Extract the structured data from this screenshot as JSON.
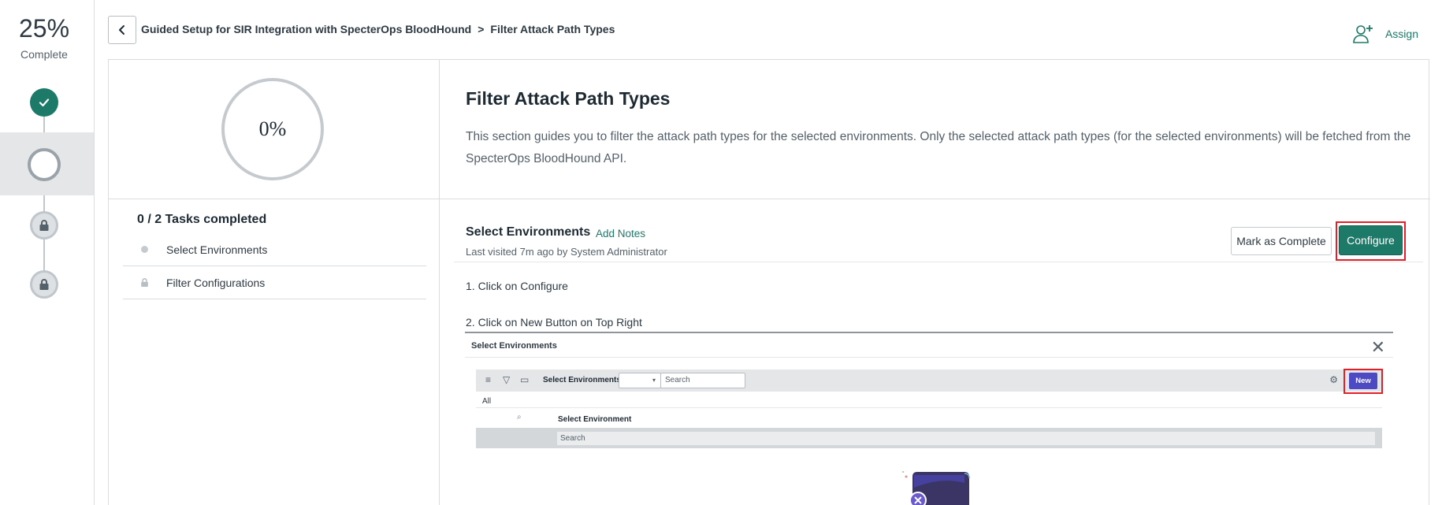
{
  "progress": {
    "percent": "25%",
    "label": "Complete"
  },
  "steps": [
    {
      "state": "done",
      "icon": "check-icon"
    },
    {
      "state": "current",
      "icon": "circle-icon"
    },
    {
      "state": "locked",
      "icon": "lock-icon"
    },
    {
      "state": "locked",
      "icon": "lock-icon"
    }
  ],
  "header": {
    "breadcrumb_parent": "Guided Setup for SIR Integration with SpecterOps BloodHound",
    "breadcrumb_sep": ">",
    "breadcrumb_current": "Filter Attack Path Types",
    "assign_label": "Assign"
  },
  "section": {
    "progress": "0%",
    "title": "Filter Attack Path Types",
    "description": "This section guides you to filter the attack path types for the selected environments. Only the selected attack path types (for the selected environments) will be fetched from the SpecterOps BloodHound API."
  },
  "tasks": {
    "summary": "0 / 2 Tasks completed",
    "items": [
      {
        "label": "Select Environments",
        "icon": "dot-icon"
      },
      {
        "label": "Filter Configurations",
        "icon": "lock-icon"
      }
    ]
  },
  "task_detail": {
    "title": "Select Environments",
    "add_notes": "Add Notes",
    "last_visited": "Last visited 7m ago by System Administrator",
    "mark_complete": "Mark as Complete",
    "configure": "Configure",
    "steps": [
      "1. Click on Configure",
      "2. Click on New Button on Top Right"
    ]
  },
  "screenshot": {
    "title": "Select Environments",
    "toolbar_label": "Select Environments",
    "search_placeholder": "Search",
    "new_label": "New",
    "all_label": "All",
    "column_header": "Select Environment",
    "filter_placeholder": "Search"
  },
  "colors": {
    "accent": "#1e7a68",
    "highlight": "#e41e26",
    "new_button": "#4e4ac4"
  }
}
